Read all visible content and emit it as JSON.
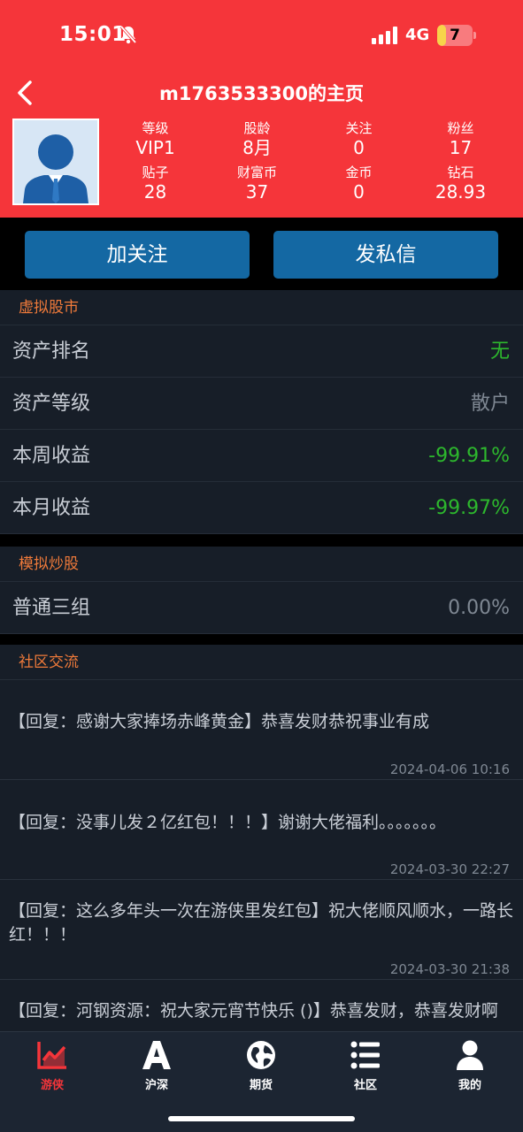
{
  "status": {
    "time": "15:01",
    "network": "4G",
    "battery": "7",
    "battery_level": 0.07
  },
  "header": {
    "title": "m1763533300的主页"
  },
  "stats": [
    {
      "label": "等级",
      "value": "VIP1"
    },
    {
      "label": "股龄",
      "value": "8月"
    },
    {
      "label": "关注",
      "value": "0"
    },
    {
      "label": "粉丝",
      "value": "17"
    },
    {
      "label": "贴子",
      "value": "28"
    },
    {
      "label": "财富币",
      "value": "37"
    },
    {
      "label": "金币",
      "value": "0"
    },
    {
      "label": "钻石",
      "value": "28.93"
    }
  ],
  "actions": {
    "follow": "加关注",
    "message": "发私信"
  },
  "virtual_market": {
    "title": "虚拟股市",
    "rows": [
      {
        "label": "资产排名",
        "value": "无",
        "color": "#2db82d"
      },
      {
        "label": "资产等级",
        "value": "散户",
        "color": "#7f8893"
      },
      {
        "label": "本周收益",
        "value": "-99.91%",
        "color": "#2db82d"
      },
      {
        "label": "本月收益",
        "value": "-99.97%",
        "color": "#2db82d"
      }
    ]
  },
  "simulation": {
    "title": "模拟炒股",
    "rows": [
      {
        "label": "普通三组",
        "value": "0.00%",
        "color": "#7f8893"
      }
    ]
  },
  "community": {
    "title": "社区交流",
    "posts": [
      {
        "text": "【回复：感谢大家捧场赤峰黄金】恭喜发财恭祝事业有成",
        "date": "2024-04-06 10:16"
      },
      {
        "text": "【回复：没事儿发２亿红包！！！】谢谢大佬福利。。。。。。。",
        "date": "2024-03-30 22:27"
      },
      {
        "text": "【回复：这么多年头一次在游侠里发红包】祝大佬顺风顺水，一路长红！！！",
        "date": "2024-03-30 21:38"
      },
      {
        "text": "【回复：河钢资源：祝大家元宵节快乐 ()】恭喜发财，恭喜发财啊",
        "date": ""
      }
    ]
  },
  "tabs": [
    {
      "label": "游侠",
      "icon": "chart-icon",
      "active": true
    },
    {
      "label": "沪深",
      "icon": "letter-a-icon",
      "active": false
    },
    {
      "label": "期货",
      "icon": "globe-icon",
      "active": false
    },
    {
      "label": "社区",
      "icon": "list-icon",
      "active": false
    },
    {
      "label": "我的",
      "icon": "person-icon",
      "active": false
    }
  ],
  "colors": {
    "brand_red": "#f5353a",
    "button_blue": "#1468a3",
    "section_orange": "#ef7a3a",
    "gain_green": "#2db82d"
  }
}
